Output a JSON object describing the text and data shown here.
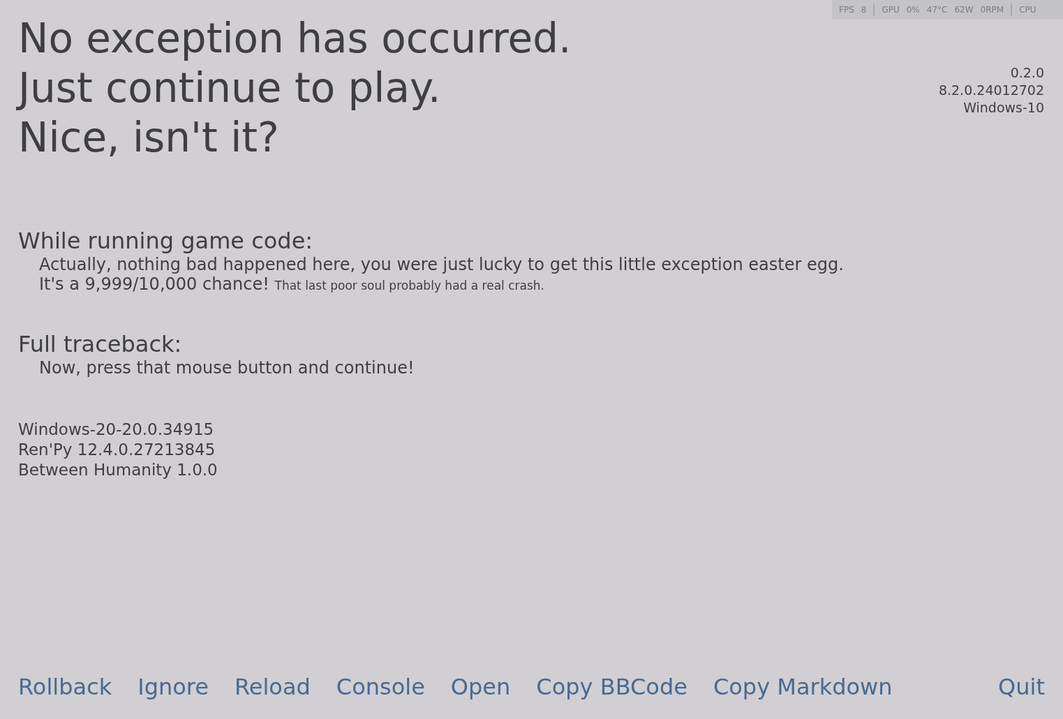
{
  "overlay": {
    "items": [
      "FPS",
      "8",
      "GPU",
      "0%",
      "47°C",
      "62W",
      "0RPM",
      "CPU"
    ]
  },
  "title_lines": [
    "No exception has occurred.",
    "Just continue to play.",
    "Nice, isn't it?"
  ],
  "version_info": [
    "0.2.0",
    "8.2.0.24012702",
    "Windows-10"
  ],
  "sections": [
    {
      "heading": "While running game code:",
      "lines": [
        "Actually, nothing bad happened here, you were just lucky to get this little exception easter egg.",
        "It's a 9,999/10,000 chance! $_{That last poor soul probably had a real crash.}$"
      ]
    },
    {
      "heading": "Full traceback:",
      "lines": [
        "Now, press that mouse button and continue!"
      ]
    }
  ],
  "system_info": [
    "Windows-20-20.0.34915",
    "Ren'Py 12.4.0.27213845",
    "Between Humanity 1.0.0"
  ],
  "actions": [
    "Rollback",
    "Ignore",
    "Reload",
    "Console",
    "Open",
    "Copy BBCode",
    "Copy Markdown"
  ],
  "quit": "Quit"
}
